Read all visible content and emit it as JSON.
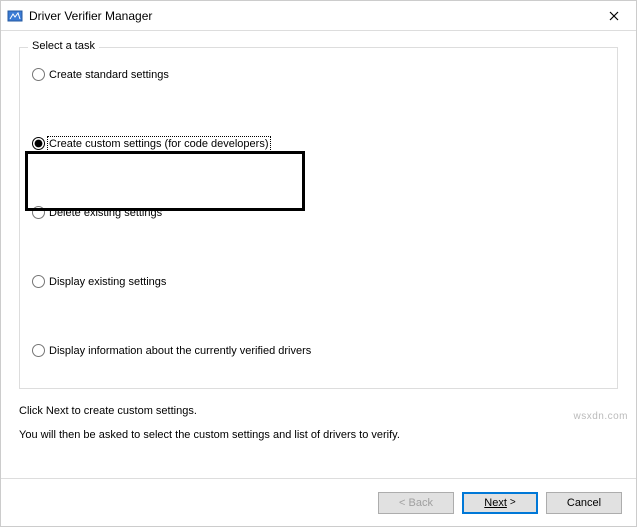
{
  "window": {
    "title": "Driver Verifier Manager"
  },
  "group": {
    "legend": "Select a task",
    "options": {
      "standard": "Create standard settings",
      "custom": "Create custom settings (for code developers)",
      "delete": "Delete existing settings",
      "display": "Display existing settings",
      "info": "Display information about the currently verified drivers"
    },
    "selected": "custom"
  },
  "instructions": {
    "line1": "Click Next to create custom settings.",
    "line2": "You will then be asked to select the custom settings and list of drivers to verify."
  },
  "buttons": {
    "back": "< Back",
    "next_prefix": "Next",
    "next_suffix": ">",
    "cancel": "Cancel"
  },
  "watermark": "wsxdn.com"
}
